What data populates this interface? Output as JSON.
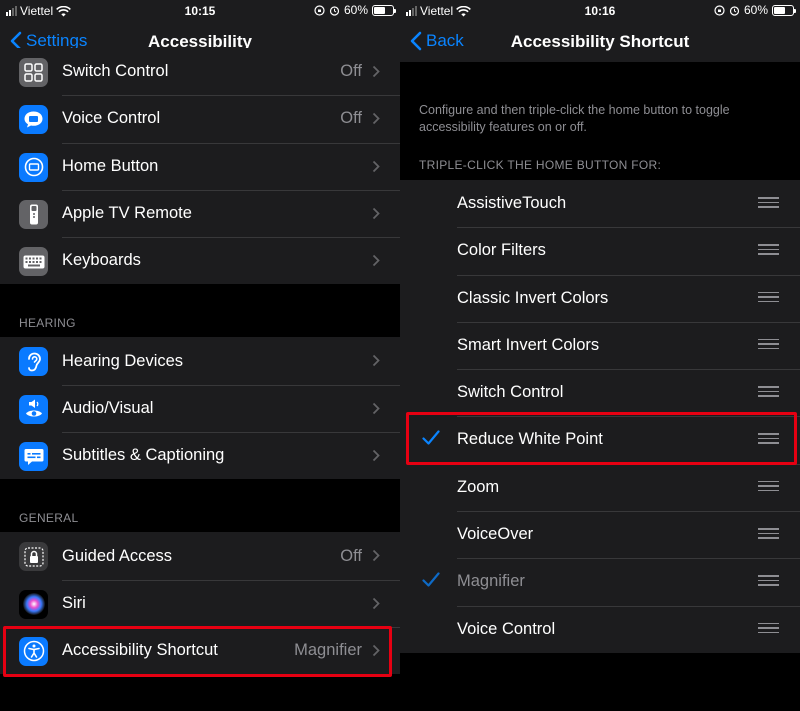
{
  "colors": {
    "accent": "#0a84ff",
    "highlight": "#e60012",
    "background": "#000000",
    "cell": "#1c1c1e",
    "secondary_text": "#8e8e93"
  },
  "left": {
    "status": {
      "carrier": "Viettel",
      "time": "10:15",
      "battery": "60%",
      "battery_level": 0.6
    },
    "nav": {
      "back": "Settings",
      "title": "Accessibility"
    },
    "physical_items": [
      {
        "label": "Switch Control",
        "value": "Off",
        "icon": "switch-control-icon"
      },
      {
        "label": "Voice Control",
        "value": "Off",
        "icon": "voice-control-icon"
      },
      {
        "label": "Home Button",
        "value": "",
        "icon": "home-button-icon"
      },
      {
        "label": "Apple TV Remote",
        "value": "",
        "icon": "apple-tv-remote-icon"
      },
      {
        "label": "Keyboards",
        "value": "",
        "icon": "keyboard-icon"
      }
    ],
    "hearing_header": "HEARING",
    "hearing_items": [
      {
        "label": "Hearing Devices",
        "value": "",
        "icon": "ear-icon"
      },
      {
        "label": "Audio/Visual",
        "value": "",
        "icon": "audio-visual-icon"
      },
      {
        "label": "Subtitles & Captioning",
        "value": "",
        "icon": "subtitles-icon"
      }
    ],
    "general_header": "GENERAL",
    "general_items": [
      {
        "label": "Guided Access",
        "value": "Off",
        "icon": "lock-icon"
      },
      {
        "label": "Siri",
        "value": "",
        "icon": "siri-icon"
      },
      {
        "label": "Accessibility Shortcut",
        "value": "Magnifier",
        "icon": "accessibility-icon"
      }
    ]
  },
  "right": {
    "status": {
      "carrier": "Viettel",
      "time": "10:16",
      "battery": "60%",
      "battery_level": 0.6
    },
    "nav": {
      "back": "Back",
      "title": "Accessibility Shortcut"
    },
    "description": "Configure and then triple-click the home button to toggle accessibility features on or off.",
    "section_header": "TRIPLE-CLICK THE HOME BUTTON FOR:",
    "items": [
      {
        "label": "AssistiveTouch",
        "checked": false
      },
      {
        "label": "Color Filters",
        "checked": false
      },
      {
        "label": "Classic Invert Colors",
        "checked": false
      },
      {
        "label": "Smart Invert Colors",
        "checked": false
      },
      {
        "label": "Switch Control",
        "checked": false
      },
      {
        "label": "Reduce White Point",
        "checked": true
      },
      {
        "label": "Zoom",
        "checked": false
      },
      {
        "label": "VoiceOver",
        "checked": false
      },
      {
        "label": "Magnifier",
        "checked": true,
        "dimmed": true
      },
      {
        "label": "Voice Control",
        "checked": false
      }
    ]
  }
}
